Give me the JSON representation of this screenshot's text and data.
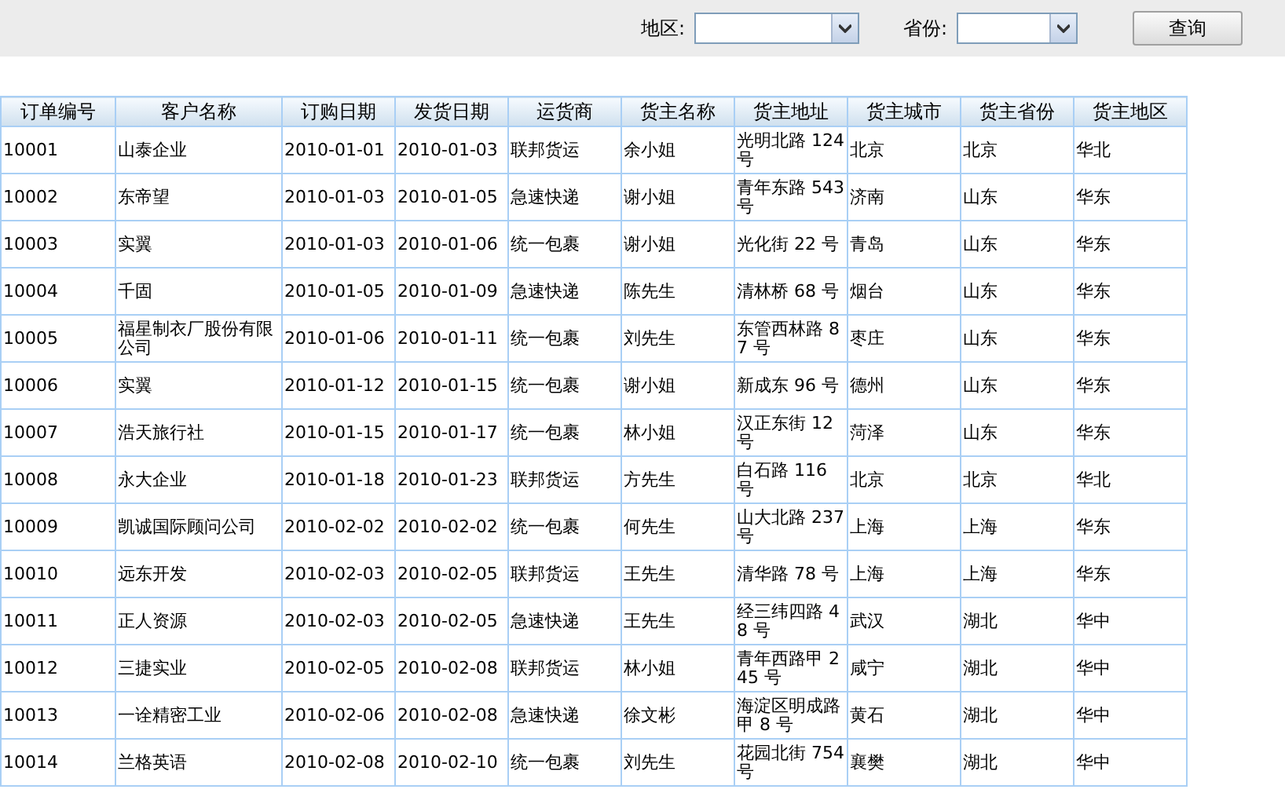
{
  "filters": {
    "region_label": "地区:",
    "province_label": "省份:",
    "search_button": "查询"
  },
  "table": {
    "columns": [
      "订单编号",
      "客户名称",
      "订购日期",
      "发货日期",
      "运货商",
      "货主名称",
      "货主地址",
      "货主城市",
      "货主省份",
      "货主地区"
    ],
    "rows": [
      [
        "10001",
        "山泰企业",
        "2010-01-01",
        "2010-01-03",
        "联邦货运",
        "余小姐",
        "光明北路 124 号",
        "北京",
        "北京",
        "华北"
      ],
      [
        "10002",
        "东帝望",
        "2010-01-03",
        "2010-01-05",
        "急速快递",
        "谢小姐",
        "青年东路 543 号",
        "济南",
        "山东",
        "华东"
      ],
      [
        "10003",
        "实翼",
        "2010-01-03",
        "2010-01-06",
        "统一包裹",
        "谢小姐",
        "光化街 22 号",
        "青岛",
        "山东",
        "华东"
      ],
      [
        "10004",
        "千固",
        "2010-01-05",
        "2010-01-09",
        "急速快递",
        "陈先生",
        "清林桥 68 号",
        "烟台",
        "山东",
        "华东"
      ],
      [
        "10005",
        "福星制衣厂股份有限公司",
        "2010-01-06",
        "2010-01-11",
        "统一包裹",
        "刘先生",
        "东管西林路 87 号",
        "枣庄",
        "山东",
        "华东"
      ],
      [
        "10006",
        "实翼",
        "2010-01-12",
        "2010-01-15",
        "统一包裹",
        "谢小姐",
        "新成东 96 号",
        "德州",
        "山东",
        "华东"
      ],
      [
        "10007",
        "浩天旅行社",
        "2010-01-15",
        "2010-01-17",
        "统一包裹",
        "林小姐",
        "汉正东街 12 号",
        "菏泽",
        "山东",
        "华东"
      ],
      [
        "10008",
        "永大企业",
        "2010-01-18",
        "2010-01-23",
        "联邦货运",
        "方先生",
        "白石路 116 号",
        "北京",
        "北京",
        "华北"
      ],
      [
        "10009",
        "凯诚国际顾问公司",
        "2010-02-02",
        "2010-02-02",
        "统一包裹",
        "何先生",
        "山大北路 237 号",
        "上海",
        "上海",
        "华东"
      ],
      [
        "10010",
        "远东开发",
        "2010-02-03",
        "2010-02-05",
        "联邦货运",
        "王先生",
        "清华路 78 号",
        "上海",
        "上海",
        "华东"
      ],
      [
        "10011",
        "正人资源",
        "2010-02-03",
        "2010-02-05",
        "急速快递",
        "王先生",
        "经三纬四路 48 号",
        "武汉",
        "湖北",
        "华中"
      ],
      [
        "10012",
        "三捷实业",
        "2010-02-05",
        "2010-02-08",
        "联邦货运",
        "林小姐",
        "青年西路甲 245 号",
        "咸宁",
        "湖北",
        "华中"
      ],
      [
        "10013",
        "一诠精密工业",
        "2010-02-06",
        "2010-02-08",
        "急速快递",
        "徐文彬",
        "海淀区明成路甲 8 号",
        "黄石",
        "湖北",
        "华中"
      ],
      [
        "10014",
        "兰格英语",
        "2010-02-08",
        "2010-02-10",
        "统一包裹",
        "刘先生",
        "花园北街 754 号",
        "襄樊",
        "湖北",
        "华中"
      ]
    ]
  }
}
